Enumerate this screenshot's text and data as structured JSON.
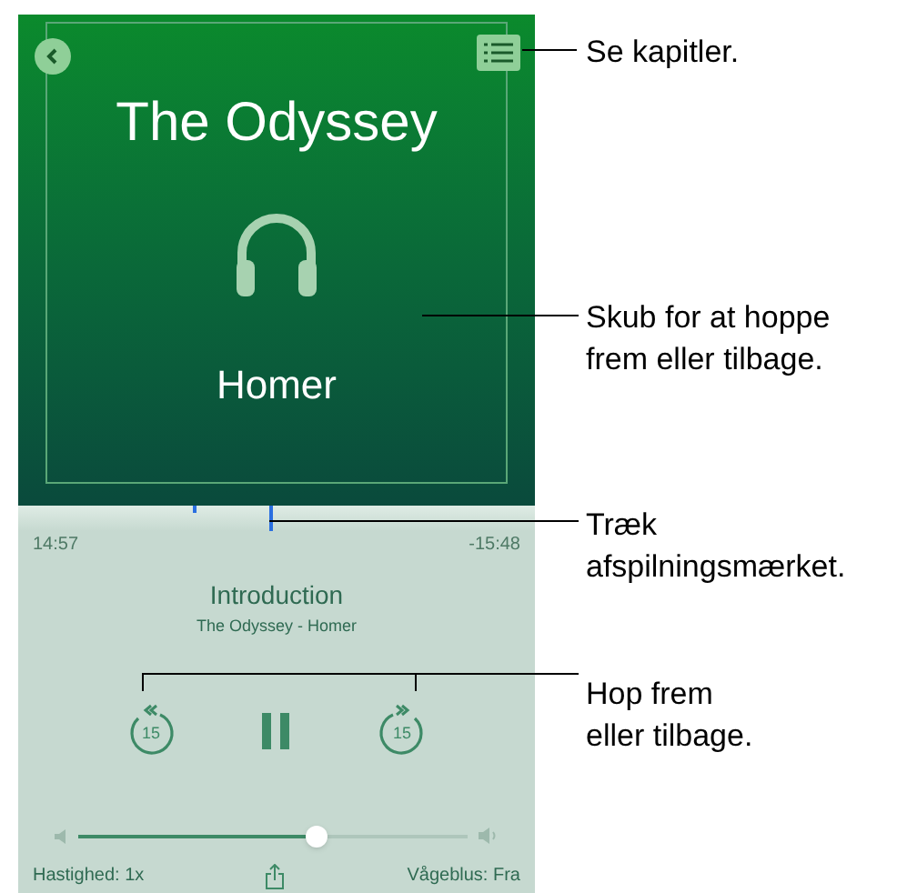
{
  "player": {
    "title": "The Odyssey",
    "author": "Homer",
    "progress": {
      "level": 0.49
    },
    "elapsed": "14:57",
    "remaining": "-15:48",
    "chapter": "Introduction",
    "subtitle": "The Odyssey - Homer",
    "skip_back": "15",
    "skip_forward": "15",
    "playing": true,
    "volume": {
      "level": 0.62
    },
    "speed": "Hastighed: 1x",
    "sleep_timer": "Vågeblus: Fra"
  },
  "callouts": [
    {
      "lines": [
        "Se kapitler."
      ]
    },
    {
      "lines": [
        "Skub for at hoppe",
        "frem eller tilbage."
      ]
    },
    {
      "lines": [
        "Træk",
        "afspilningsmærket."
      ]
    },
    {
      "lines": [
        "Hop frem",
        "eller tilbage."
      ]
    }
  ]
}
